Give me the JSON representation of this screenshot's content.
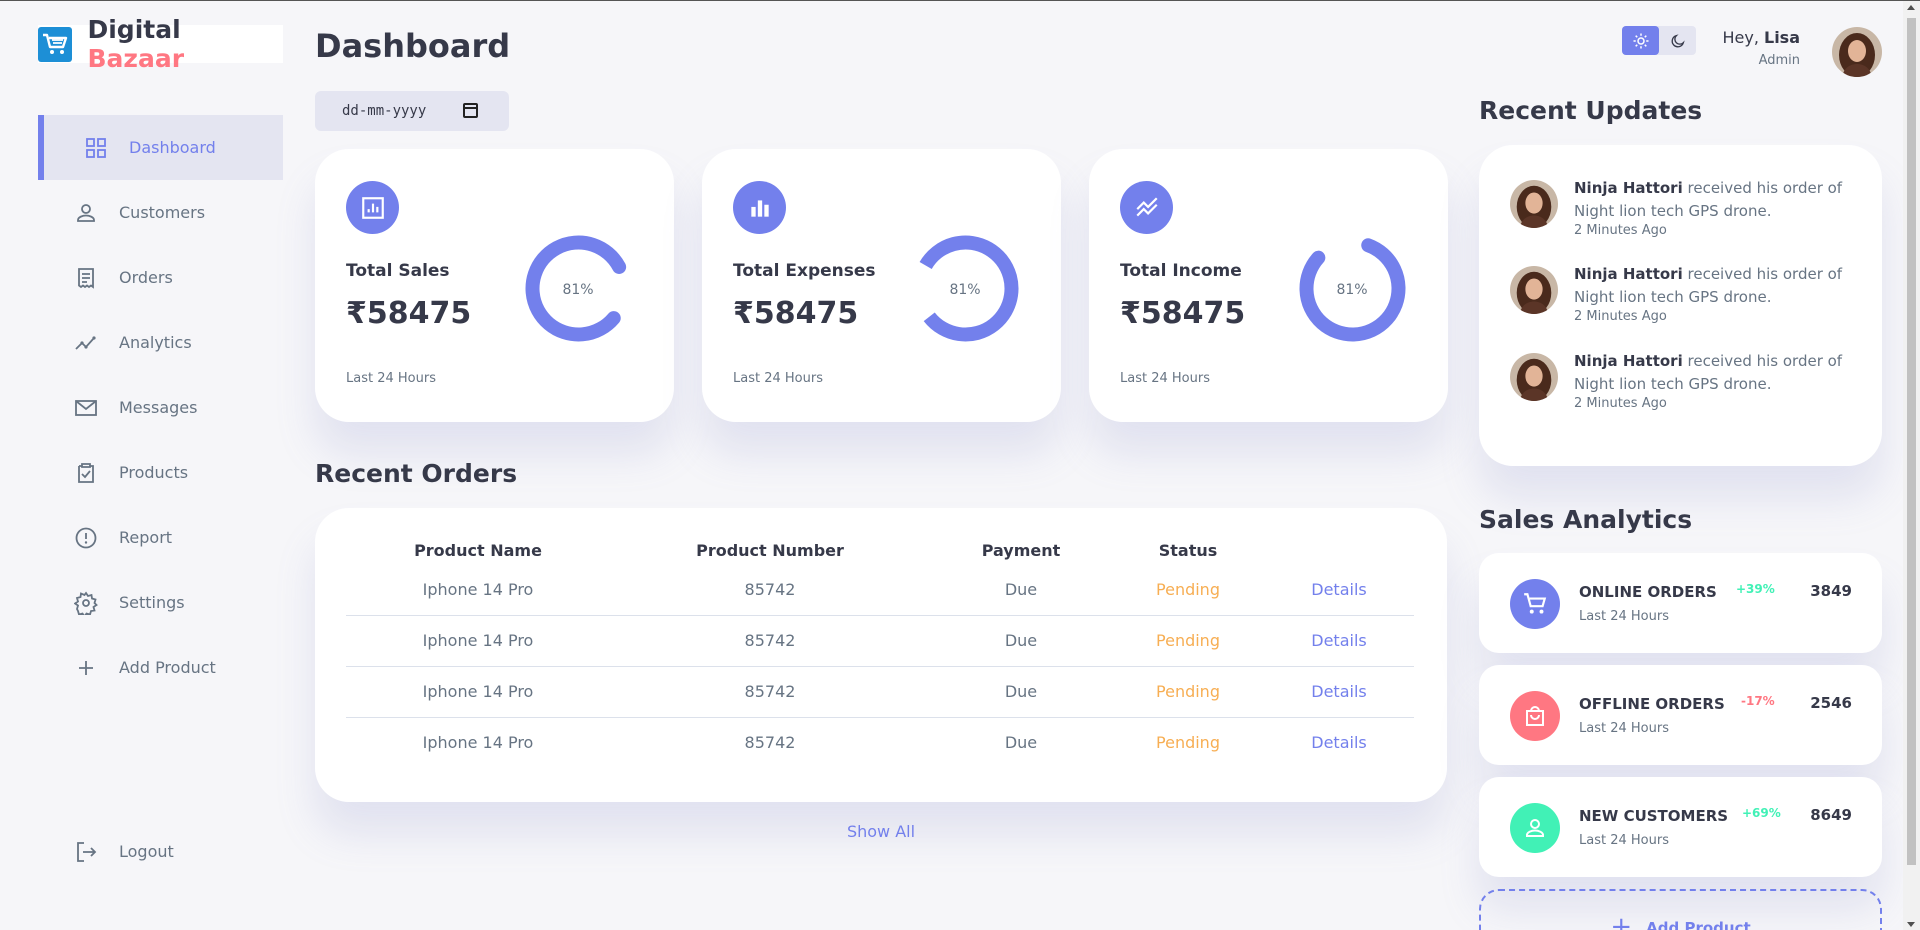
{
  "brand": {
    "part1": "Digital",
    "part2": "Bazaar",
    "accent_color": "#ff7782"
  },
  "colors": {
    "primary": "#7380ec",
    "danger": "#ff7782",
    "success": "#41f1b6",
    "warning": "#f7ae53"
  },
  "sidebar": {
    "items": [
      {
        "label": "Dashboard",
        "icon": "grid-icon",
        "active": true
      },
      {
        "label": "Customers",
        "icon": "person-icon"
      },
      {
        "label": "Orders",
        "icon": "receipt-icon"
      },
      {
        "label": "Analytics",
        "icon": "insights-icon"
      },
      {
        "label": "Messages",
        "icon": "mail-icon"
      },
      {
        "label": "Products",
        "icon": "inventory-icon"
      },
      {
        "label": "Report",
        "icon": "report-icon"
      },
      {
        "label": "Settings",
        "icon": "gear-icon"
      },
      {
        "label": "Add Product",
        "icon": "plus-icon"
      }
    ],
    "logout": {
      "label": "Logout",
      "icon": "logout-icon"
    }
  },
  "main": {
    "title": "Dashboard",
    "date_placeholder": "dd-mm-yyyy",
    "cards": [
      {
        "title": "Total Sales",
        "value": "₹58475",
        "percent_label": "81%",
        "percent": 81,
        "footer": "Last 24 Hours",
        "icon": "analytics-icon"
      },
      {
        "title": "Total Expenses",
        "value": "₹58475",
        "percent_label": "81%",
        "percent": 81,
        "footer": "Last 24 Hours",
        "icon": "bar-chart-icon"
      },
      {
        "title": "Total Income",
        "value": "₹58475",
        "percent_label": "81%",
        "percent": 81,
        "footer": "Last 24 Hours",
        "icon": "stacked-line-icon"
      }
    ],
    "recent_orders": {
      "title": "Recent Orders",
      "columns": [
        "Product Name",
        "Product Number",
        "Payment",
        "Status",
        ""
      ],
      "rows": [
        {
          "name": "Iphone 14 Pro",
          "number": "85742",
          "payment": "Due",
          "status": "Pending",
          "action": "Details"
        },
        {
          "name": "Iphone 14 Pro",
          "number": "85742",
          "payment": "Due",
          "status": "Pending",
          "action": "Details"
        },
        {
          "name": "Iphone 14 Pro",
          "number": "85742",
          "payment": "Due",
          "status": "Pending",
          "action": "Details"
        },
        {
          "name": "Iphone 14 Pro",
          "number": "85742",
          "payment": "Due",
          "status": "Pending",
          "action": "Details"
        }
      ],
      "show_all": "Show All"
    }
  },
  "right": {
    "profile": {
      "greeting": "Hey, ",
      "name": "Lisa",
      "role": "Admin"
    },
    "theme_toggle": {
      "light_icon": "sun-icon",
      "dark_icon": "moon-icon",
      "active": "light"
    },
    "recent_updates": {
      "title": "Recent Updates",
      "items": [
        {
          "name": "Ninja Hattori",
          "text": " received his order of Night lion tech GPS drone.",
          "time": "2 Minutes Ago"
        },
        {
          "name": "Ninja Hattori",
          "text": " received his order of Night lion tech GPS drone.",
          "time": "2 Minutes Ago"
        },
        {
          "name": "Ninja Hattori",
          "text": " received his order of Night lion tech GPS drone.",
          "time": "2 Minutes Ago"
        }
      ]
    },
    "sales_analytics": {
      "title": "Sales Analytics",
      "items": [
        {
          "title": "ONLINE ORDERS",
          "footer": "Last 24 Hours",
          "change": "+39%",
          "value": "3849",
          "icon": "cart-icon",
          "color": "#7380ec",
          "change_color": "#41f1b6"
        },
        {
          "title": "OFFLINE ORDERS",
          "footer": "Last 24 Hours",
          "change": "-17%",
          "value": "2546",
          "icon": "bag-icon",
          "color": "#ff7782",
          "change_color": "#ff7782"
        },
        {
          "title": "NEW CUSTOMERS",
          "footer": "Last 24 Hours",
          "change": "+69%",
          "value": "8649",
          "icon": "person-icon",
          "color": "#41f1b6",
          "change_color": "#41f1b6"
        }
      ],
      "add_product": "Add Product"
    }
  }
}
